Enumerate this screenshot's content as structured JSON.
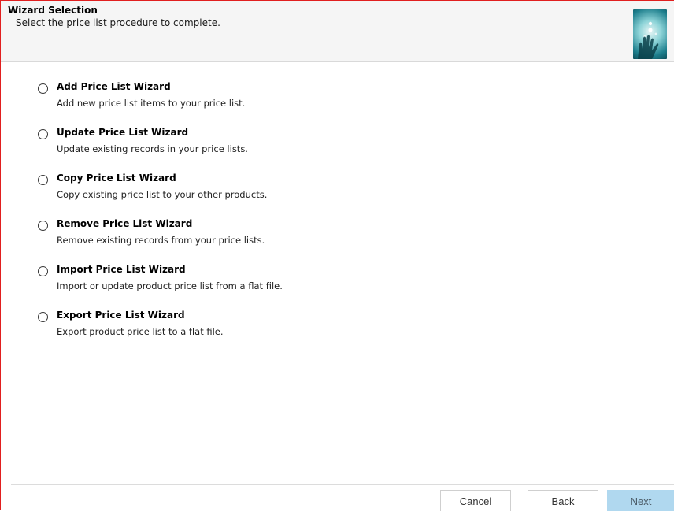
{
  "header": {
    "title": "Wizard Selection",
    "subtitle": "Select the price list procedure to complete.",
    "image_icon": "wizard-hand-icon"
  },
  "options": [
    {
      "title": "Add Price List Wizard",
      "description": "Add new price list items to your price list.",
      "selected": false
    },
    {
      "title": "Update Price List Wizard",
      "description": "Update existing records in your price lists.",
      "selected": false
    },
    {
      "title": "Copy Price List Wizard",
      "description": "Copy existing price list to your other products.",
      "selected": false
    },
    {
      "title": "Remove Price List Wizard",
      "description": "Remove existing records from your price lists.",
      "selected": false
    },
    {
      "title": "Import Price List Wizard",
      "description": "Import or update product price list from a flat file.",
      "selected": false
    },
    {
      "title": "Export Price List Wizard",
      "description": "Export product price list to a flat file.",
      "selected": false
    }
  ],
  "footer": {
    "cancel_label": "Cancel",
    "back_label": "Back",
    "next_label": "Next"
  },
  "colors": {
    "frame_border": "#e11f1f",
    "header_bg": "#f5f5f5",
    "next_button_bg": "#b0d8ef"
  }
}
